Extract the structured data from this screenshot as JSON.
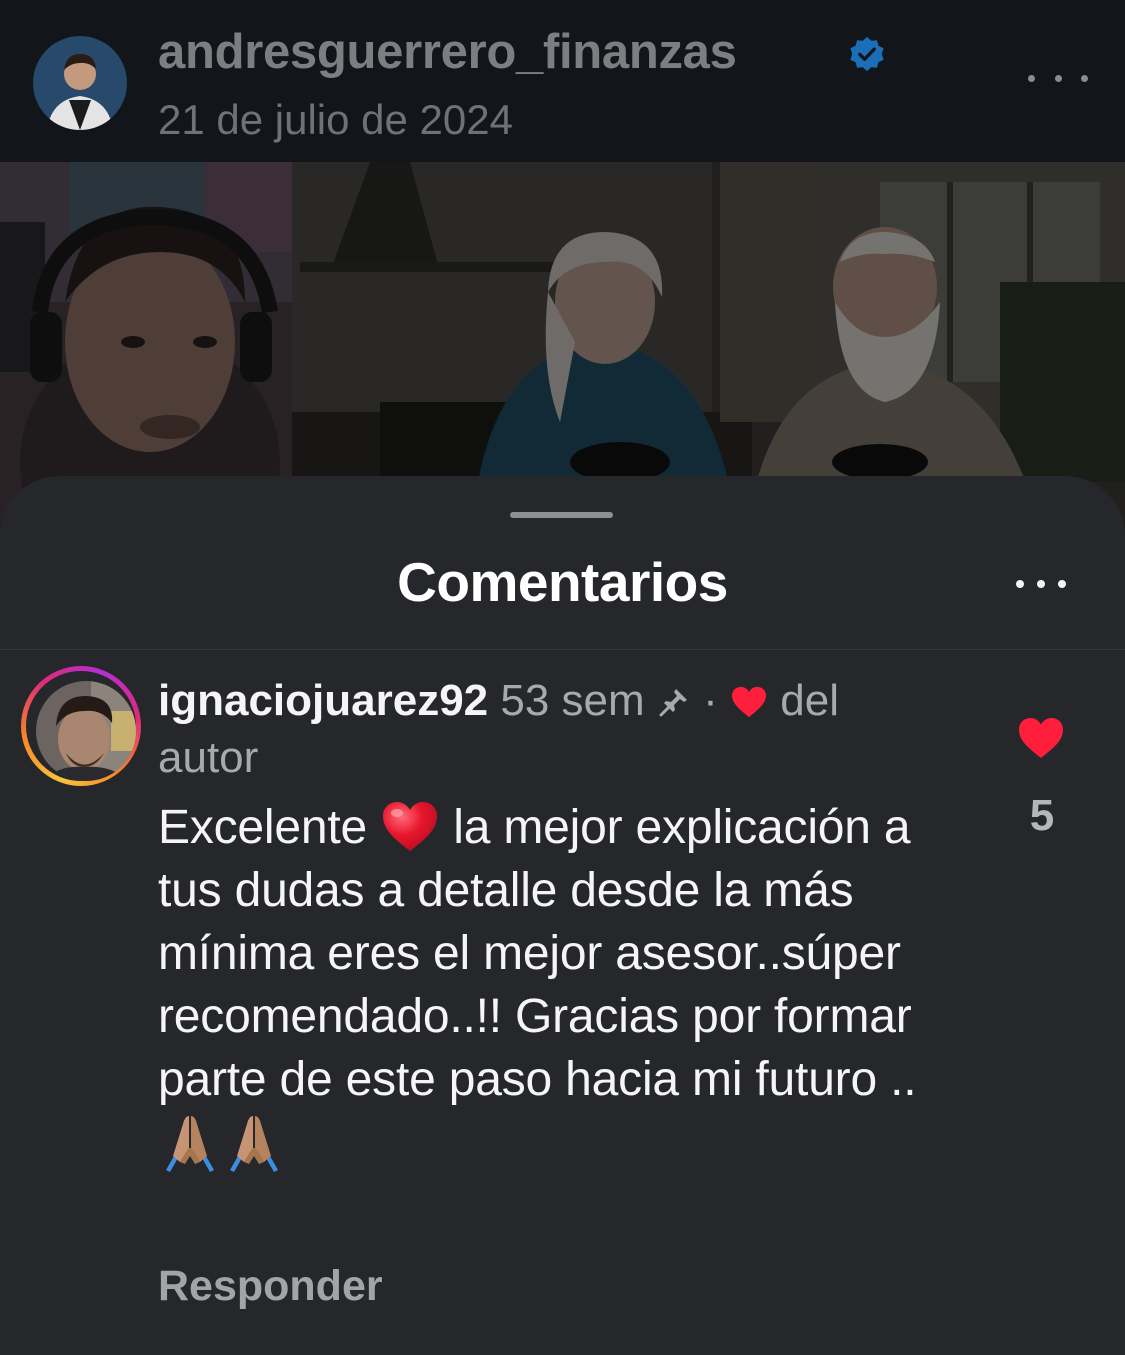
{
  "post": {
    "username": "andresguerrero_finanzas",
    "date": "21 de julio de 2024"
  },
  "sheet": {
    "title": "Comentarios"
  },
  "comment": {
    "username": "ignaciojuarez92",
    "time": "53 sem",
    "separator": "·",
    "author_like_label_1": "del",
    "author_like_label_2": "autor",
    "text_1": "Excelente ",
    "text_2": " la mejor explicación a tus dudas a detalle desde la más mínima eres el mejor asesor..súper recomendado..!! Gracias por formar parte de este paso hacia mi futuro .. ",
    "like_count": "5",
    "reply_label": "Responder"
  },
  "icons": {
    "verified": "verified-badge-icon",
    "more": "more-horizontal-icon",
    "pin": "pin-icon",
    "heart": "heart-icon",
    "pray": "folded-hands-emoji"
  },
  "colors": {
    "heart": "#ff1f3d",
    "verified": "#1d8cf0",
    "sheet_bg": "#25272b"
  }
}
